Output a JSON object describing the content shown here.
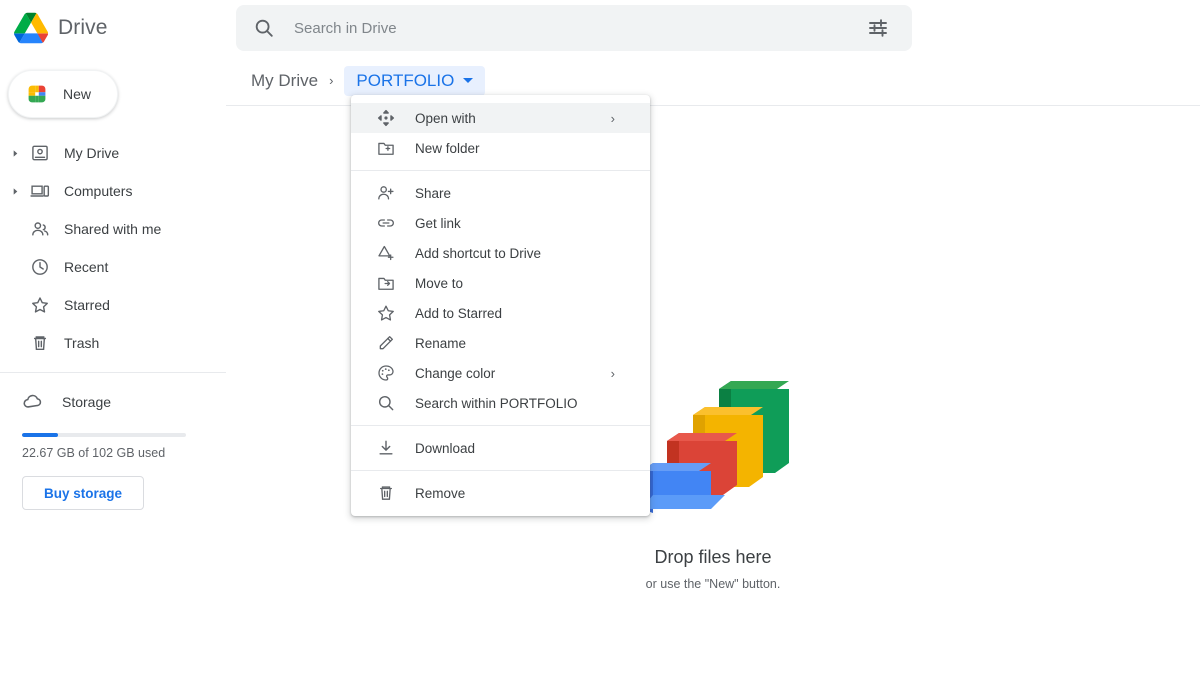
{
  "app": {
    "brand_name": "Drive",
    "logo_icon": "drive-logo-icon"
  },
  "search": {
    "placeholder": "Search in Drive",
    "value": "",
    "search_icon": "search-icon",
    "tune_icon": "tune-filter-icon"
  },
  "sidebar": {
    "new_button": {
      "label": "New",
      "icon": "plus-icon"
    },
    "items": [
      {
        "label": "My Drive",
        "icon": "my-drive-icon",
        "expandable": true
      },
      {
        "label": "Computers",
        "icon": "computers-icon",
        "expandable": true
      },
      {
        "label": "Shared with me",
        "icon": "shared-with-me-icon",
        "expandable": false
      },
      {
        "label": "Recent",
        "icon": "clock-icon",
        "expandable": false
      },
      {
        "label": "Starred",
        "icon": "star-icon",
        "expandable": false
      },
      {
        "label": "Trash",
        "icon": "trash-icon",
        "expandable": false
      }
    ],
    "storage": {
      "label": "Storage",
      "icon": "cloud-icon",
      "used_text": "22.67 GB of 102 GB used",
      "percent": 22,
      "bar_color": "#1a73e8",
      "buy_button": "Buy storage"
    }
  },
  "breadcrumb": {
    "root": "My Drive",
    "separator": "›",
    "current": "PORTFOLIO",
    "current_bg": "#e8f0fe",
    "current_color": "#1a73e8"
  },
  "context_menu": {
    "groups": [
      [
        {
          "label": "Open with",
          "icon": "move-arrows-icon",
          "submenu": true,
          "highlighted": true
        },
        {
          "label": "New folder",
          "icon": "new-folder-icon",
          "submenu": false,
          "highlighted": false
        }
      ],
      [
        {
          "label": "Share",
          "icon": "person-add-icon",
          "submenu": false,
          "highlighted": false
        },
        {
          "label": "Get link",
          "icon": "link-icon",
          "submenu": false,
          "highlighted": false
        },
        {
          "label": "Add shortcut to Drive",
          "icon": "add-shortcut-icon",
          "submenu": false,
          "highlighted": false
        },
        {
          "label": "Move to",
          "icon": "move-to-folder-icon",
          "submenu": false,
          "highlighted": false
        },
        {
          "label": "Add to Starred",
          "icon": "star-icon",
          "submenu": false,
          "highlighted": false
        },
        {
          "label": "Rename",
          "icon": "pencil-icon",
          "submenu": false,
          "highlighted": false
        },
        {
          "label": "Change color",
          "icon": "palette-icon",
          "submenu": true,
          "highlighted": false
        },
        {
          "label": "Search within PORTFOLIO",
          "icon": "search-icon",
          "submenu": false,
          "highlighted": false
        }
      ],
      [
        {
          "label": "Download",
          "icon": "download-icon",
          "submenu": false,
          "highlighted": false
        }
      ],
      [
        {
          "label": "Remove",
          "icon": "trash-icon",
          "submenu": false,
          "highlighted": false
        }
      ]
    ],
    "submenu_arrow": "›"
  },
  "main": {
    "empty_state": {
      "illustration": "folder-trays-illustration",
      "title": "Drop files here",
      "subtitle": "or use the \"New\" button."
    }
  }
}
